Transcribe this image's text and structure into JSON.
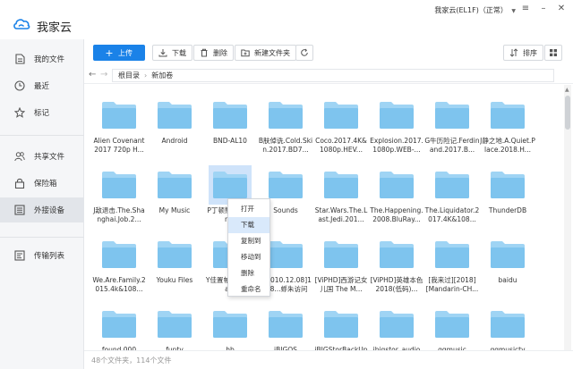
{
  "app": {
    "name": "我家云",
    "account": "我家云(EL1F)（正常）"
  },
  "colors": {
    "accent": "#1a82e8",
    "folder": "#7ec4ee",
    "folder_tab": "#9fd4f4",
    "selection": "#cfe3fa"
  },
  "sidebar": {
    "items": [
      {
        "label": "我的文件",
        "icon": "file-icon"
      },
      {
        "label": "最近",
        "icon": "clock-icon"
      },
      {
        "label": "标记",
        "icon": "star-icon"
      },
      {
        "label": "共享文件",
        "icon": "users-icon"
      },
      {
        "label": "保险箱",
        "icon": "lock-icon"
      },
      {
        "label": "外接设备",
        "icon": "hdd-icon",
        "active": true
      },
      {
        "label": "传输列表",
        "icon": "transfer-icon"
      }
    ]
  },
  "toolbar": {
    "upload": "上传",
    "download": "下载",
    "delete": "删除",
    "new_folder": "新建文件夹",
    "sort": "排序"
  },
  "breadcrumb": {
    "root": "根目录",
    "current": "新加卷"
  },
  "files": [
    "Alien Covenant 2017 720p H...",
    "Android",
    "BND-AL10",
    "B肤倬诜.Cold.Skin.2017.BD7...",
    "Coco.2017.4K&1080p.HEV...",
    "Explosion.2017.1080p.WEB-...",
    "G牛历险记.Ferdinand.2017.B...",
    "J静之地.A.Quiet.Place.2018.H...",
    "J敌退击.The.Shanghai.Job.2...",
    "My Music",
    "P丁顿熊...ngton...",
    "Sounds",
    "Star.Wars.The.Last.Jedi.201...",
    "The.Happening.2008.BluRay...",
    "The.Liquidator.2017.4K&108...",
    "ThunderDB",
    "We.Are.Family.2015.4k&108...",
    "Youku Files",
    "Y佳置帕...he.Bra...",
    "...2010.12.08]14 8...蜉朱访问[2...",
    "[ViPHD]西游记女儿国 The M...",
    "[ViPHD]英雄本色2018(低码)...",
    "[我来过][2018][Mandarin-CH...",
    "baidu",
    "found.000",
    "funtv",
    "hb",
    "iBIGOS",
    "iBIGStorBackUp",
    "ibigstor_audio",
    "qqmusic",
    "qqmusictv"
  ],
  "context_menu": [
    "打开",
    "下载",
    "复制到",
    "移动到",
    "删除",
    "重命名"
  ],
  "status": "48个文件夹，114个文件"
}
